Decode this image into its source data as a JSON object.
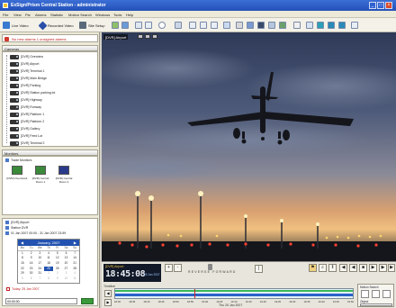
{
  "window": {
    "title": "ExSign/Prism Central Station - administrator",
    "controls": [
      "_",
      "□",
      "×"
    ]
  },
  "menu": [
    "File",
    "View",
    "Ptz",
    "Alarms",
    "Statistic",
    "Motion Search",
    "Windows",
    "Tools",
    "Help"
  ],
  "toolbar": {
    "live_label": "Live Video",
    "recorded_label": "Recorded Video",
    "setup_label": "Site Setup"
  },
  "alarms": {
    "status": "No new alarms   1 unsigned alarms"
  },
  "cameras": {
    "header": "Cameras",
    "items": [
      "[DVR] Overview",
      "[DVR] Airport",
      "[DVR] Terminal 1",
      "[DVR] Main Bridge",
      "[DVR] Parking",
      "[DVR] Station parking lot",
      "[DVR] Highway",
      "[DVR] Runway",
      "[DVR] Platform 1",
      "[DVR] Platform 2",
      "[DVR] Gallery",
      "[DVR] Feed Lot",
      "[DVR] Terminal 2"
    ]
  },
  "monitors": {
    "header": "Monitors",
    "group": "Trade Monitors",
    "items": [
      "[DVR] Overview1",
      "[DVR] Central Room 1",
      "[DVR] Central Room 2"
    ]
  },
  "search": {
    "rows": [
      "[DVR] Airport",
      "Station DVR",
      "01 Jan 2007 00:00 - 31 Jan 2007 23:59"
    ],
    "calendar": {
      "month": "January, 2007",
      "dows": [
        "Mo",
        "Tu",
        "We",
        "Th",
        "Fr",
        "Sa",
        "Su"
      ],
      "weeks": [
        [
          "1",
          "2",
          "3",
          "4",
          "5",
          "6",
          "7"
        ],
        [
          "8",
          "9",
          "10",
          "11",
          "12",
          "13",
          "14"
        ],
        [
          "15",
          "16",
          "17",
          "18",
          "19",
          "20",
          "21"
        ],
        [
          "22",
          "23",
          "24",
          "25",
          "26",
          "27",
          "28"
        ],
        [
          "29",
          "30",
          "31",
          "1",
          "2",
          "3",
          "4"
        ],
        [
          "5",
          "6",
          "7",
          "8",
          "9",
          "10",
          "11"
        ]
      ],
      "selected": "25"
    },
    "today": "Today: 25 Jan 2007",
    "bottom_value": "00:00:00"
  },
  "video": {
    "label": "[DVR] Airport"
  },
  "playback": {
    "camera": "[DVR] Airport",
    "time": "18:45:08",
    "date": "25 Jan 2007",
    "speed_label": "REVERSE  FORWARD",
    "timeline_title": "Timeline",
    "timeline_date": "Thu 25 Jan 2007",
    "ticks": [
      "18:30",
      "18:35",
      "18:40",
      "18:45",
      "18:50",
      "18:55",
      "19:00",
      "19:05",
      "19:10",
      "19:15",
      "19:20",
      "19:25",
      "19:30",
      "19:35",
      "19:40",
      "19:45",
      "19:50"
    ],
    "motion_search_label": "Motion Search",
    "motion_sensitivity_label": "Object"
  },
  "colors": {
    "title_bar": "#2350b8",
    "recorded_bar": "#2a62c9",
    "motion_bar": "#3ab85a",
    "sky_top": "#3b4a6a",
    "sunset": "#e8a868"
  }
}
